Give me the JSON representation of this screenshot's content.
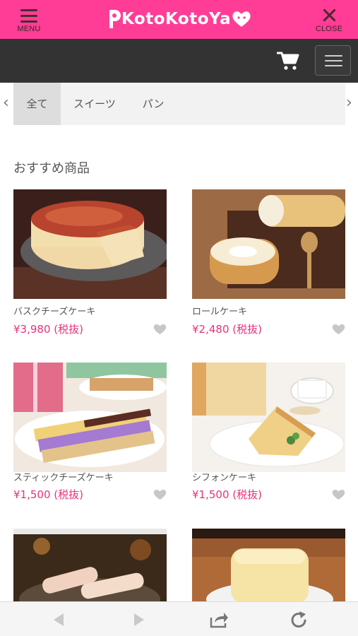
{
  "header": {
    "menu_label": "MENU",
    "close_label": "CLOSE",
    "logo_text": "KotoKotoYa"
  },
  "tabs": {
    "items": [
      "全て",
      "スイーツ",
      "パン"
    ],
    "active": "全て"
  },
  "section": {
    "title": "おすすめ商品"
  },
  "products": [
    {
      "name": "バスクチーズケーキ",
      "price": "¥3,980 (税抜)"
    },
    {
      "name": "ロールケーキ",
      "price": "¥2,480 (税抜)"
    },
    {
      "name": "スティックチーズケーキ",
      "price": "¥1,500 (税抜)"
    },
    {
      "name": "シフォンケーキ",
      "price": "¥1,500 (税抜)"
    }
  ],
  "colors": {
    "brand_pink": "#ff3d96",
    "price_pink": "#e8337b",
    "dark_bar": "#333333"
  },
  "icons": [
    "menu-icon",
    "close-icon",
    "cart-icon",
    "hamburger-icon",
    "heart-icon",
    "back-icon",
    "forward-icon",
    "share-icon",
    "reload-icon"
  ]
}
